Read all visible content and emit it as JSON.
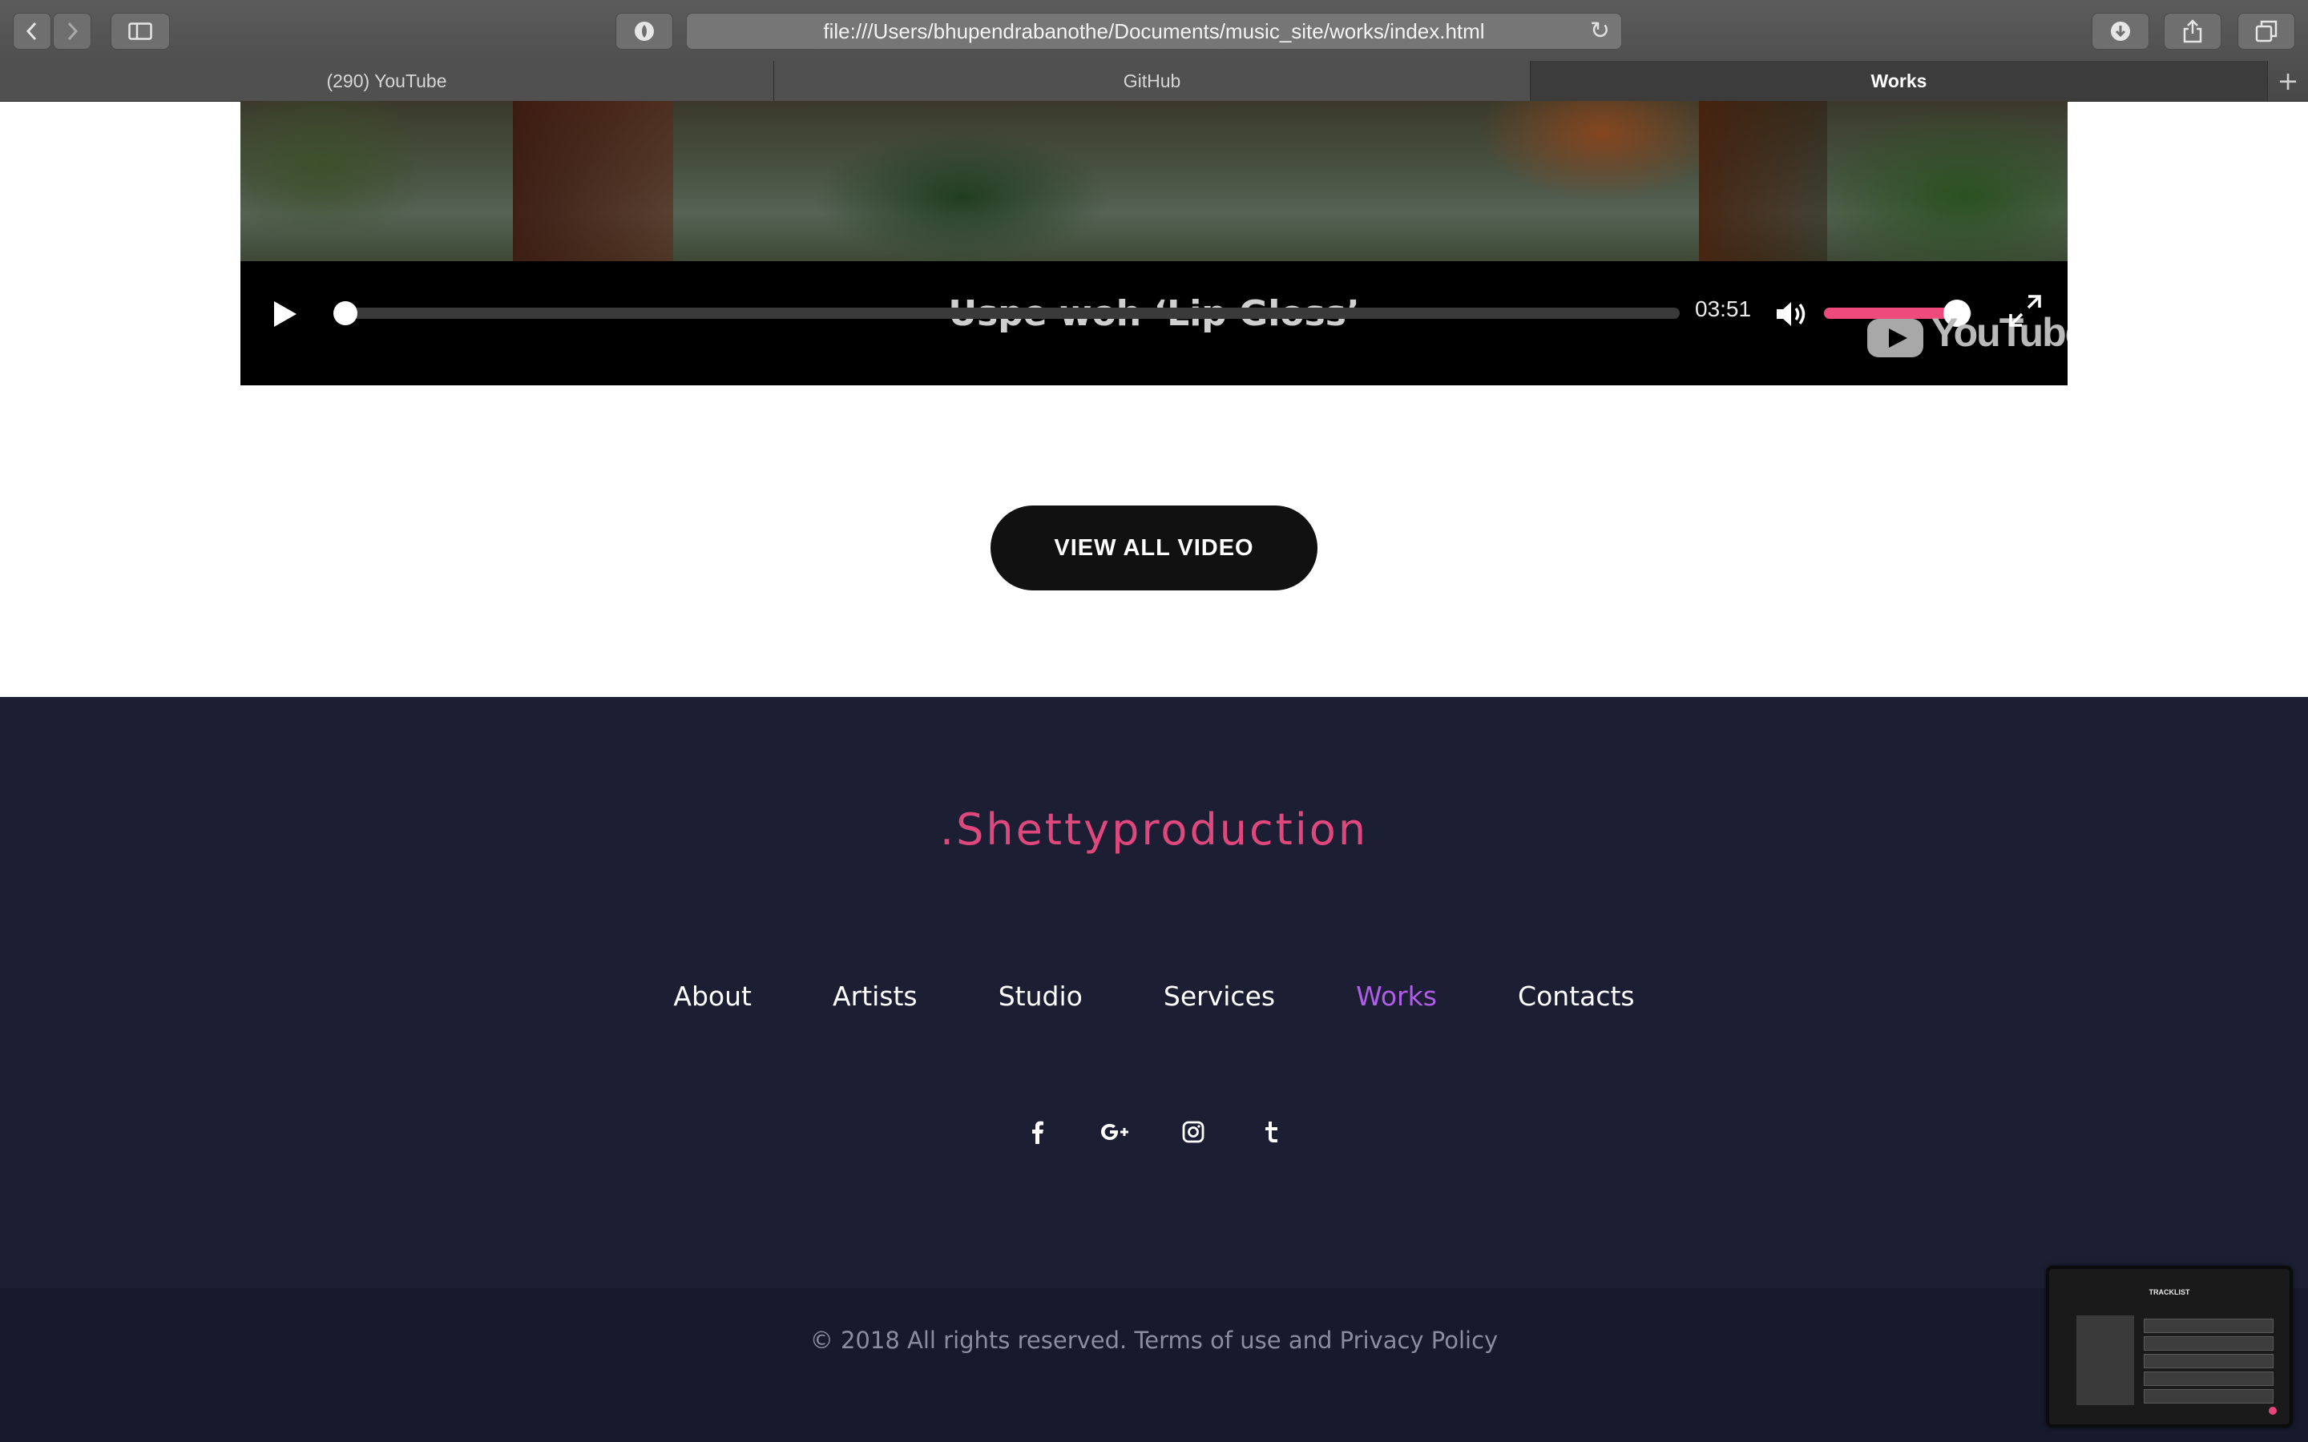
{
  "browser": {
    "url": "file:///Users/bhupendrabanothe/Documents/music_site/works/index.html",
    "tabs": [
      {
        "label": "(290) YouTube",
        "active": false
      },
      {
        "label": "GitHub",
        "active": false
      },
      {
        "label": "Works",
        "active": true
      }
    ],
    "icons": {
      "back": "chevron-left-icon",
      "forward": "chevron-right-icon",
      "sidebar": "sidebar-icon",
      "privacy": "shield-icon",
      "reload": "reload-icon",
      "download": "download-icon",
      "share": "share-icon",
      "tab_overview": "tabs-icon",
      "new_tab": "plus-icon"
    }
  },
  "video": {
    "subtitle": "Uspe woh ‘Lip Gloss’",
    "duration": "03:51",
    "progress": 0,
    "volume": 0.9,
    "brand_logo": "YouTube"
  },
  "cta": {
    "label": "VIEW ALL VIDEO"
  },
  "footer": {
    "brand": ".Shettyproduction",
    "nav": [
      {
        "label": "About",
        "active": false
      },
      {
        "label": "Artists",
        "active": false
      },
      {
        "label": "Studio",
        "active": false
      },
      {
        "label": "Services",
        "active": false
      },
      {
        "label": "Works",
        "active": true
      },
      {
        "label": "Contacts",
        "active": false
      }
    ],
    "social": [
      "facebook-icon",
      "google-plus-icon",
      "instagram-icon",
      "tumblr-icon"
    ],
    "copyright": "© 2018 All rights reserved. Terms of use and Privacy Policy"
  },
  "preview": {
    "title": "TRACKLIST"
  },
  "colors": {
    "brand_pink": "#e0487d",
    "nav_active": "#b05de8",
    "footer_bg": "#1c1f33",
    "copyright_bg": "#161a2c",
    "volume_fill": "#ee4b7c"
  }
}
